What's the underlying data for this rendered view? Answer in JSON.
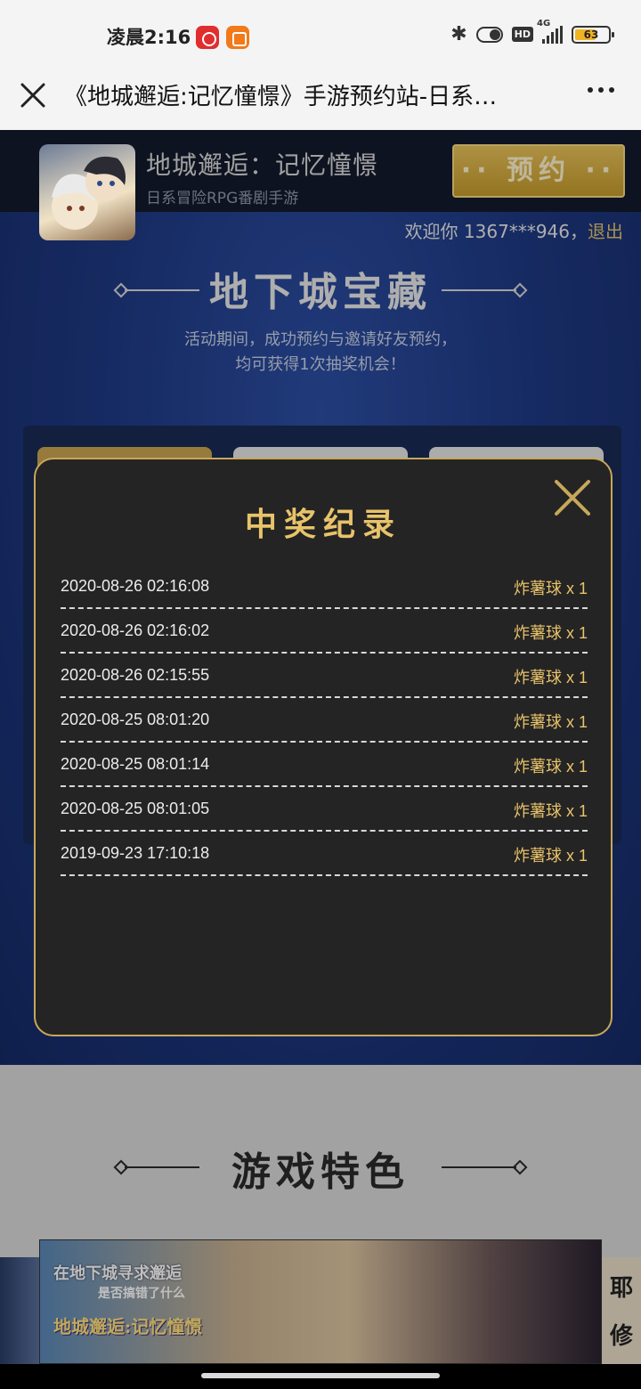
{
  "status_bar": {
    "time": "凌晨2:16",
    "network": "4G",
    "hd": "HD",
    "battery": "63"
  },
  "browser": {
    "title": "《地城邂逅:记忆憧憬》手游预约站-日系…"
  },
  "page": {
    "game_name": "地城邂逅：记忆憧憬",
    "game_subtitle": "日系冒险RPG番剧手游",
    "reserve_button": "·· 预约 ··",
    "welcome_prefix": "欢迎你 1367***946，",
    "logout": "退出",
    "section1_title": "地下城宝藏",
    "activity_line1": "活动期间，成功预约与邀请好友预约，",
    "activity_line2": "均可获得1次抽奖机会！",
    "section2_title": "游戏特色",
    "banner_logo_line1": "在地下城寻求邂逅",
    "banner_logo_line2": "是否搞错了什么",
    "banner_logo_line3": "地城邂逅:记忆憧憬",
    "banner_side_text_1": "耶",
    "banner_side_text_2": "修"
  },
  "modal": {
    "title": "中奖纪录",
    "records": [
      {
        "time": "2020-08-26 02:16:08",
        "prize": "炸薯球 x 1"
      },
      {
        "time": "2020-08-26 02:16:02",
        "prize": "炸薯球 x 1"
      },
      {
        "time": "2020-08-26 02:15:55",
        "prize": "炸薯球 x 1"
      },
      {
        "time": "2020-08-25 08:01:20",
        "prize": "炸薯球 x 1"
      },
      {
        "time": "2020-08-25 08:01:14",
        "prize": "炸薯球 x 1"
      },
      {
        "time": "2020-08-25 08:01:05",
        "prize": "炸薯球 x 1"
      },
      {
        "time": "2019-09-23 17:10:18",
        "prize": "炸薯球 x 1"
      }
    ]
  },
  "colors": {
    "gold": "#e8c36a",
    "modal_bg": "#242424",
    "page_blue": "#1f3a85"
  }
}
